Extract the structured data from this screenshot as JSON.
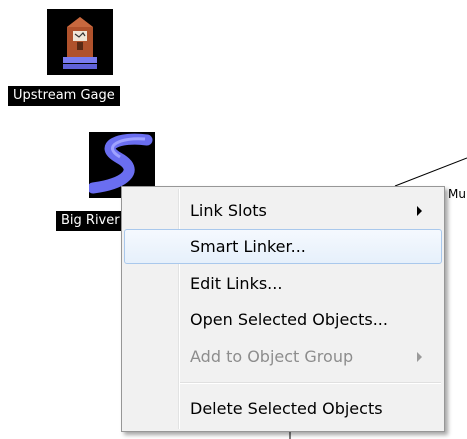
{
  "canvas": {
    "nodes": [
      {
        "label": "Upstream Gage",
        "icon": "stream-gage-icon"
      },
      {
        "label": "Big River",
        "icon": "river-reach-icon"
      }
    ],
    "partial_label": "Mu"
  },
  "context_menu": {
    "items": [
      {
        "label": "Link Slots",
        "submenu": true,
        "enabled": true
      },
      {
        "label": "Smart Linker...",
        "submenu": false,
        "enabled": true,
        "highlighted": true
      },
      {
        "label": "Edit Links...",
        "submenu": false,
        "enabled": true
      },
      {
        "label": "Open Selected Objects...",
        "submenu": false,
        "enabled": true
      },
      {
        "label": "Add to Object Group",
        "submenu": true,
        "enabled": false
      },
      {
        "label": "Delete Selected Objects",
        "submenu": false,
        "enabled": true
      }
    ]
  },
  "colors": {
    "menu_background": "#f1f1f1",
    "menu_hover_border": "#a9c8ec",
    "disabled_text": "#8d8d8d",
    "river_blue": "#6a6ef0",
    "gage_brown": "#b0522c"
  }
}
